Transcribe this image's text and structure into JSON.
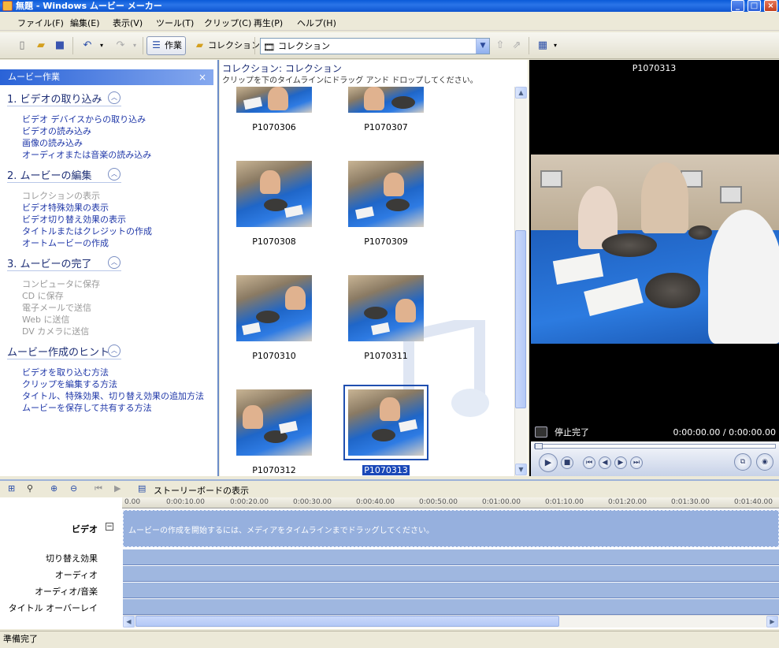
{
  "window": {
    "title": "無題 - Windows ムービー メーカー"
  },
  "menu": [
    "ファイル(F)",
    "編集(E)",
    "表示(V)",
    "ツール(T)",
    "クリップ(C)",
    "再生(P)",
    "ヘルプ(H)"
  ],
  "toolbar": {
    "tasks_label": "作業",
    "collections_label": "コレクション",
    "collection_select": "コレクション"
  },
  "taskpane": {
    "header": "ムービー作業",
    "close": "×",
    "sections": [
      {
        "title": "1. ビデオの取り込み",
        "links": [
          {
            "label": "ビデオ デバイスからの取り込み",
            "enabled": true
          },
          {
            "label": "ビデオの読み込み",
            "enabled": true
          },
          {
            "label": "画像の読み込み",
            "enabled": true
          },
          {
            "label": "オーディオまたは音楽の読み込み",
            "enabled": true
          }
        ]
      },
      {
        "title": "2. ムービーの編集",
        "links": [
          {
            "label": "コレクションの表示",
            "enabled": false
          },
          {
            "label": "ビデオ特殊効果の表示",
            "enabled": true
          },
          {
            "label": "ビデオ切り替え効果の表示",
            "enabled": true
          },
          {
            "label": "タイトルまたはクレジットの作成",
            "enabled": true
          },
          {
            "label": "オートムービーの作成",
            "enabled": true
          }
        ]
      },
      {
        "title": "3. ムービーの完了",
        "links": [
          {
            "label": "コンピュータに保存",
            "enabled": false
          },
          {
            "label": "CD に保存",
            "enabled": false
          },
          {
            "label": "電子メールで送信",
            "enabled": false
          },
          {
            "label": "Web に送信",
            "enabled": false
          },
          {
            "label": "DV カメラに送信",
            "enabled": false
          }
        ]
      },
      {
        "title": "ムービー作成のヒント",
        "links": [
          {
            "label": "ビデオを取り込む方法",
            "enabled": true
          },
          {
            "label": "クリップを編集する方法",
            "enabled": true
          },
          {
            "label": "タイトル、特殊効果、切り替え効果の追加方法",
            "enabled": true
          },
          {
            "label": "ムービーを保存して共有する方法",
            "enabled": true
          }
        ]
      }
    ]
  },
  "collection": {
    "title": "コレクション: コレクション",
    "subtitle": "クリップを下のタイムラインにドラッグ アンド ドロップしてください。",
    "clips": [
      "P1070306",
      "P1070307",
      "P1070308",
      "P1070309",
      "P1070310",
      "P1070311",
      "P1070312",
      "P1070313"
    ],
    "selected": "P1070313"
  },
  "preview": {
    "title": "P1070313",
    "status": "停止完了",
    "time": "0:00:00.00 / 0:00:00.00"
  },
  "timeline": {
    "storyboard_label": "ストーリーボードの表示",
    "ticks": [
      "0.00",
      "0:00:10.00",
      "0:00:20.00",
      "0:00:30.00",
      "0:00:40.00",
      "0:00:50.00",
      "0:01:00.00",
      "0:01:10.00",
      "0:01:20.00",
      "0:01:30.00",
      "0:01:40.00"
    ],
    "tracks": [
      "ビデオ",
      "切り替え効果",
      "オーディオ",
      "オーディオ/音楽",
      "タイトル オーバーレイ"
    ],
    "video_message": "ムービーの作成を開始するには、メディアをタイムラインまでドラッグしてください。"
  },
  "status": "準備完了",
  "colors": {
    "link": "#1f37a8",
    "header": "#2a63d7",
    "selection": "#1a48b8"
  }
}
